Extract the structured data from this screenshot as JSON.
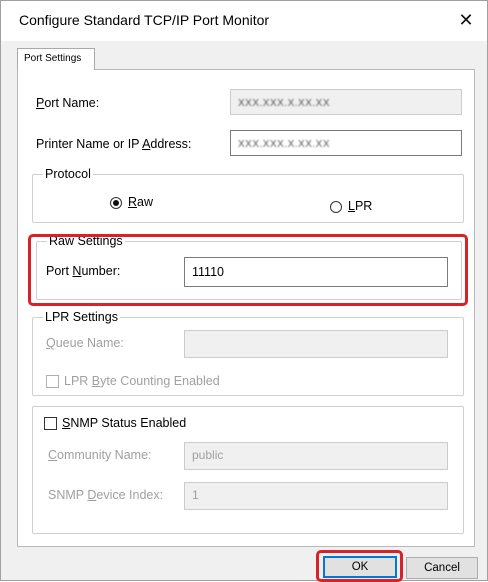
{
  "window": {
    "title": "Configure Standard TCP/IP Port Monitor",
    "close_glyph": "✕"
  },
  "tabs": [
    {
      "label": "Port Settings"
    }
  ],
  "port_name": {
    "label_pre": "",
    "label_u": "P",
    "label_post": "ort Name:",
    "value": "XXX.XXX.X.XX.XX"
  },
  "printer_address": {
    "label_pre": "Printer Name or IP ",
    "label_u": "A",
    "label_post": "ddress:",
    "value": "XXX.XXX.X.XX.XX"
  },
  "protocol": {
    "legend": "Protocol",
    "raw": {
      "label_pre": "",
      "label_u": "R",
      "label_post": "aw",
      "selected": true
    },
    "lpr": {
      "label_pre": "",
      "label_u": "L",
      "label_post": "PR",
      "selected": false
    }
  },
  "raw_settings": {
    "legend": "Raw Settings",
    "port_number_label_pre": "Port ",
    "port_number_label_u": "N",
    "port_number_label_post": "umber:",
    "port_number_value": "11110"
  },
  "lpr_settings": {
    "legend": "LPR Settings",
    "queue_label_pre": "",
    "queue_label_u": "Q",
    "queue_label_post": "ueue Name:",
    "queue_value": "",
    "byte_count_pre": "LPR ",
    "byte_count_u": "B",
    "byte_count_post": "yte Counting Enabled"
  },
  "snmp": {
    "legend_pre": "",
    "legend_u": "S",
    "legend_post": "NMP Status Enabled",
    "community_label_pre": "",
    "community_label_u": "C",
    "community_label_post": "ommunity Name:",
    "community_value": "public",
    "device_index_label_pre": "SNMP ",
    "device_index_label_u": "D",
    "device_index_label_post": "evice Index:",
    "device_index_value": "1"
  },
  "buttons": {
    "ok": "OK",
    "cancel": "Cancel"
  },
  "colors": {
    "highlight": "#d8222a",
    "focus_border": "#0078d7"
  }
}
